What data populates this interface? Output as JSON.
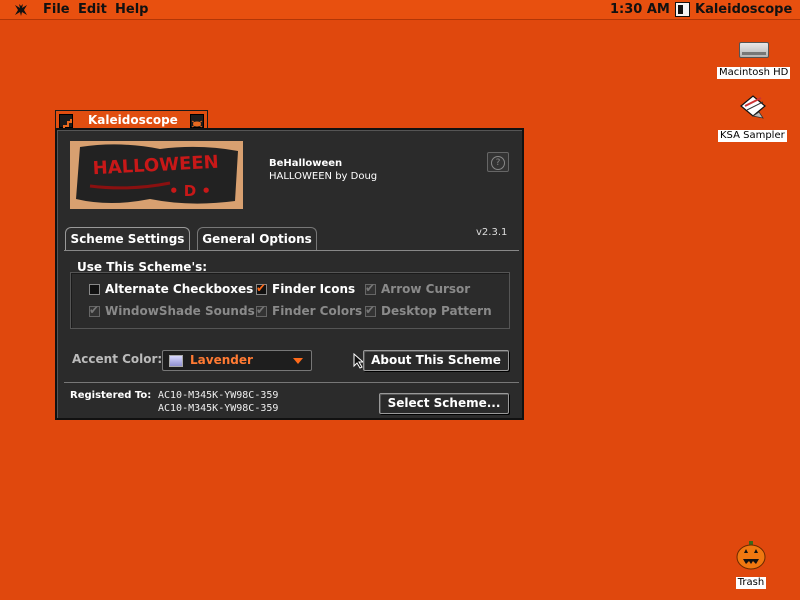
{
  "menubar": {
    "items": [
      "File",
      "Edit",
      "Help"
    ],
    "clock": "1:30 AM",
    "active_app": "Kaleidoscope",
    "apple_icon": "halloween-bat-icon"
  },
  "desktop": {
    "icons": [
      {
        "label": "Macintosh HD",
        "icon": "hard-disk-icon"
      },
      {
        "label": "KSA Sampler",
        "icon": "ksa-sampler-icon"
      },
      {
        "label": "Trash",
        "icon": "pumpkin-trash-icon"
      }
    ]
  },
  "window": {
    "title": "Kaleidoscope",
    "scheme_name": "BeHalloween",
    "scheme_author": "HALLOWEEN by Doug",
    "banner_text": "HALLOWEEN",
    "help_label": "?",
    "version": "v2.3.1",
    "tabs": [
      {
        "label": "Scheme Settings",
        "active": true
      },
      {
        "label": "General Options",
        "active": false
      }
    ],
    "use_scheme_label": "Use This Scheme's:",
    "checkboxes": [
      {
        "label": "Alternate Checkboxes",
        "checked": false,
        "enabled": true
      },
      {
        "label": "Finder Icons",
        "checked": true,
        "enabled": true
      },
      {
        "label": "Arrow Cursor",
        "checked": true,
        "enabled": false
      },
      {
        "label": "WindowShade Sounds",
        "checked": true,
        "enabled": false
      },
      {
        "label": "Finder Colors",
        "checked": true,
        "enabled": false
      },
      {
        "label": "Desktop Pattern",
        "checked": true,
        "enabled": false
      }
    ],
    "accent_label": "Accent Color:",
    "accent_value": "Lavender",
    "about_button": "About This Scheme",
    "registered_label": "Registered To:",
    "registered_lines": [
      "AC10-M345K-YW98C-359",
      "AC10-M345K-YW98C-359"
    ],
    "select_button": "Select Scheme..."
  },
  "colors": {
    "desktop": "#e0480d",
    "accent_text": "#ff7a33",
    "window_body": "#2b2b2b"
  }
}
